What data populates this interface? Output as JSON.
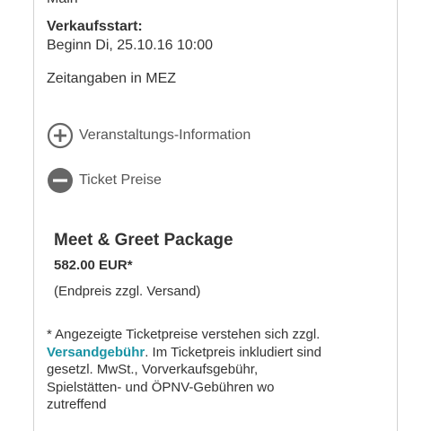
{
  "top_cut_text": "Main",
  "sale": {
    "heading": "Verkaufsstart:",
    "start": "Beginn Di, 25.10.16 10:00"
  },
  "timezone_note": "Zeitangaben in MEZ",
  "sections": {
    "info": {
      "label": "Veranstaltungs-Information",
      "icon": "plus-circle-icon",
      "expanded": false
    },
    "prices": {
      "label": "Ticket Preise",
      "icon": "minus-circle-icon",
      "expanded": true
    }
  },
  "package": {
    "title": "Meet & Greet Package",
    "price": "582.00 EUR*",
    "note": "(Endpreis zzgl. Versand)"
  },
  "disclaimer": {
    "line1": "* Angezeigte Ticketpreise verstehen sich zzgl.",
    "link": "Versandgebühr",
    "line2_rest": ". Im Ticketpreis inkludiert sind",
    "line3": "gesetzl. MwSt., Vorverkaufsgebühr,",
    "line4": "Spielstätten- und ÖPNV-Gebühren wo",
    "line5": "zutreffend"
  },
  "colors": {
    "link": "#1a93a4",
    "icon": "#666666",
    "rail": "#d2d2d2"
  }
}
